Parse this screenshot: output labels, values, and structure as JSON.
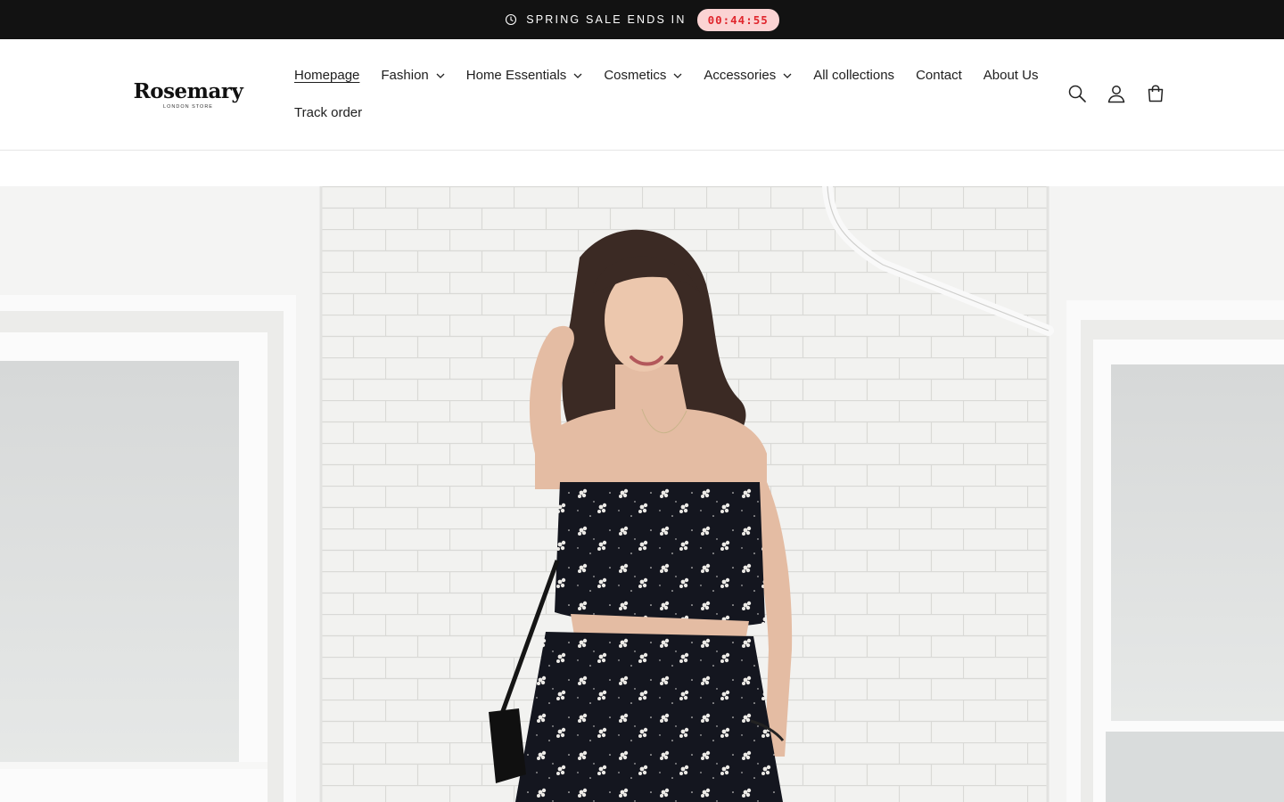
{
  "announcement": {
    "text": "SPRING SALE ENDS IN",
    "timer": "00:44:55",
    "icon": "clock-icon"
  },
  "logo": {
    "name": "Rosemary",
    "tagline": "LONDON STORE"
  },
  "nav": {
    "items": [
      {
        "label": "Homepage",
        "has_dropdown": false,
        "active": true
      },
      {
        "label": "Fashion",
        "has_dropdown": true
      },
      {
        "label": "Home Essentials",
        "has_dropdown": true
      },
      {
        "label": "Cosmetics",
        "has_dropdown": true
      },
      {
        "label": "Accessories",
        "has_dropdown": true
      },
      {
        "label": "All collections",
        "has_dropdown": false
      },
      {
        "label": "Contact",
        "has_dropdown": false
      },
      {
        "label": "About Us",
        "has_dropdown": false
      },
      {
        "label": "Track order",
        "has_dropdown": false
      }
    ]
  },
  "header_icons": [
    "search-icon",
    "account-icon",
    "cart-icon"
  ],
  "colors": {
    "announcement_bg": "#121212",
    "timer_bg": "#fbd3d3",
    "timer_text": "#e0262d"
  }
}
